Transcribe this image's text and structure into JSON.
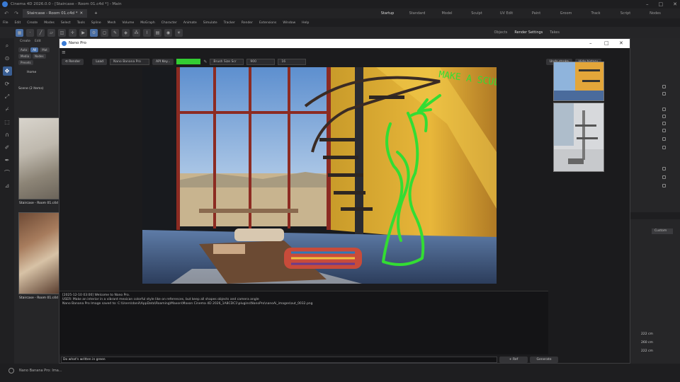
{
  "window": {
    "title": "Cinema 4D 2026.0.0 - [Staircase - Room 01.c4d *] - Main",
    "controls": [
      "–",
      "□",
      "✕"
    ]
  },
  "tabbar": {
    "document_tab": "Staircase - Room 01.c4d *",
    "add_tab": "+",
    "layouts": [
      "Startup",
      "Standard",
      "Model",
      "Sculpt",
      "UV Edit",
      "Paint",
      "Groom",
      "Track",
      "Script",
      "Nodes"
    ],
    "active_layout": "Startup"
  },
  "menubar": [
    "File",
    "Edit",
    "Create",
    "Modes",
    "Select",
    "Tools",
    "Spline",
    "Mesh",
    "Volume",
    "MoGraph",
    "Character",
    "Animate",
    "Simulate",
    "Tracker",
    "Render",
    "Extensions",
    "Window",
    "Help"
  ],
  "right_tabs": [
    "Objects",
    "Render Settings",
    "Takes"
  ],
  "right_tabs_active": "Render Settings",
  "left_panel": {
    "header": [
      "Create",
      "Edit"
    ],
    "chips": [
      "Auto",
      "All",
      "Mat",
      "Media",
      "Nodes",
      "Presets"
    ],
    "home": "Home",
    "scene_label": "Scene (2 Items)",
    "thumb_captions": [
      "Staircase - Room 01.c4d",
      "Staircase - Room 01.c4d"
    ]
  },
  "right_panel": {
    "select_value": "Custom",
    "cells": [
      "222 cm",
      "260 cm",
      "222 cm"
    ]
  },
  "status": {
    "text": "Nano Banana Pro: Ima..."
  },
  "dialog": {
    "title": "Nano Pro",
    "menu_icon": "≡",
    "toolbar": {
      "render": "⟲ Render",
      "load": "Load",
      "model_select": "Nano Banana Pro",
      "api_key": "API Key...",
      "color": "#33cc33",
      "brush_size_label": "Brush Size Scr",
      "brush_value": "900",
      "aspect": "16",
      "undo_stroke": "Undo stroke",
      "hide_history": "Hide history"
    },
    "annotation_text": "MAKE A SCULPTURE",
    "log_lines": [
      "[2025-12-10 03:00] Welcome to Nano Pro.",
      "USER: Make an interior in a vibrant mexican colorful style like on references, but keep all shapes objects and camera angle",
      "Nano Banana Pro Image saved to: C:\\Users\\danil\\AppData\\Roaming\\Maxon\\Maxon Cinema 4D 2026_1A8CDC1\\plugins\\NanoPro\\nanoAi_images\\out_0032.png"
    ],
    "prompt_value": "Do what's written in green",
    "ref_button": "+ Ref",
    "generate_button": "Generate"
  }
}
